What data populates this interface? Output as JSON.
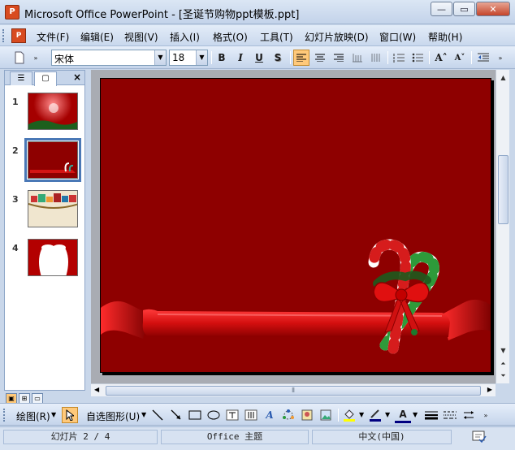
{
  "window": {
    "title": "Microsoft Office PowerPoint - [圣诞节购物ppt模板.ppt]",
    "minimize": "—",
    "restore": "▭",
    "close": "✕"
  },
  "menu": {
    "items": [
      "文件(F)",
      "编辑(E)",
      "视图(V)",
      "插入(I)",
      "格式(O)",
      "工具(T)",
      "幻灯片放映(D)",
      "窗口(W)",
      "帮助(H)"
    ]
  },
  "toolbar": {
    "font_name": "宋体",
    "font_size": "18",
    "bold": "B",
    "italic": "I",
    "underline": "U",
    "shadow": "S",
    "grow_font": "A˄",
    "shrink_font": "A˅"
  },
  "slide_panel": {
    "tab_outline": "☰",
    "tab_slides": "▢",
    "close": "×",
    "slides": [
      {
        "number": "1"
      },
      {
        "number": "2",
        "selected": true
      },
      {
        "number": "3"
      },
      {
        "number": "4"
      }
    ]
  },
  "drawing": {
    "draw_label": "绘图(R)",
    "autoshapes_label": "自选图形(U)"
  },
  "status": {
    "slide": "幻灯片 2 / 4",
    "theme": "Office 主题",
    "language": "中文(中国)"
  },
  "colors": {
    "slide_bg": "#8e0000",
    "ribbon": "#d41414",
    "selection": "#4a78b6"
  }
}
